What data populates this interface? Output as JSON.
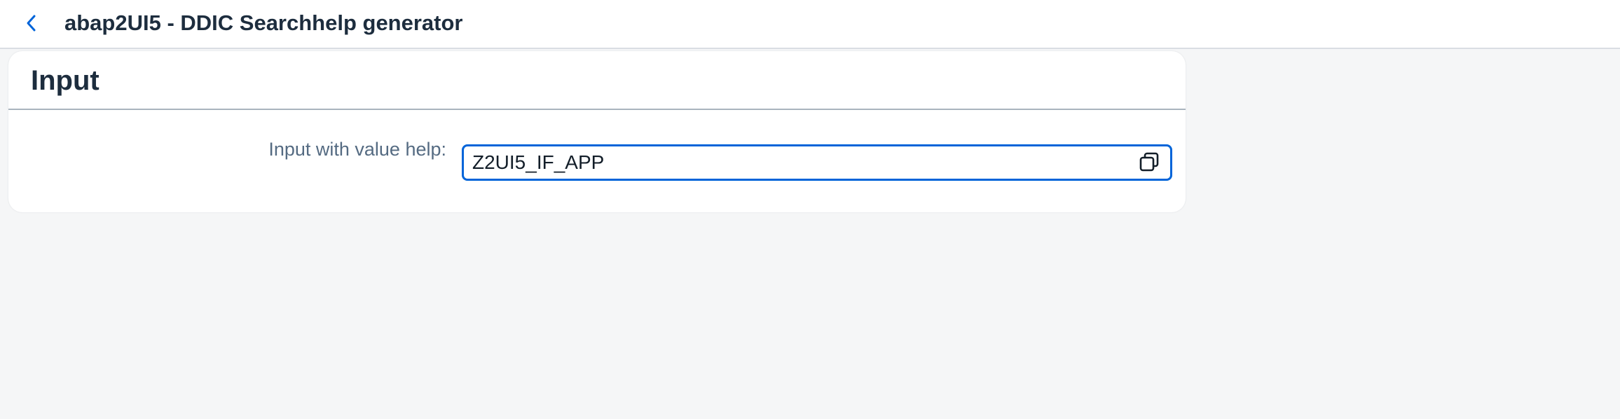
{
  "shell": {
    "back_icon": "chevron-left-icon",
    "title": "abap2UI5 - DDIC Searchhelp generator"
  },
  "panel": {
    "title": "Input"
  },
  "form": {
    "label": "Input with value help:",
    "value": "Z2UI5_IF_APP",
    "value_help_icon": "value-help-icon"
  },
  "colors": {
    "accent": "#0064d9",
    "title_text": "#1d2d3e",
    "label_text": "#556b82",
    "background": "#f5f6f7"
  }
}
